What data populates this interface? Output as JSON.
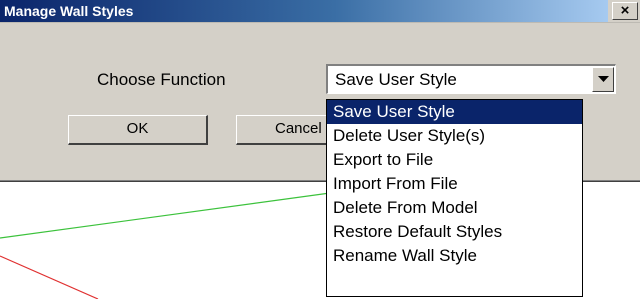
{
  "dialog": {
    "title": "Manage Wall Styles",
    "close_label": "×"
  },
  "function_label": "Choose Function",
  "function_select": {
    "value": "Save User Style",
    "options": [
      "Save User Style",
      "Delete User Style(s)",
      "Export to File",
      "Import From File",
      "Delete From Model",
      "Restore Default Styles",
      "Rename Wall Style"
    ],
    "selected_index": 0
  },
  "buttons": {
    "ok_label": "OK",
    "cancel_label": "Cancel"
  },
  "colors": {
    "dialog_bg": "#d4d0c8",
    "title_bar": "#0a246a",
    "selection": "#0a246a",
    "green_line": "#3cc23c",
    "red_line": "#e03030"
  }
}
